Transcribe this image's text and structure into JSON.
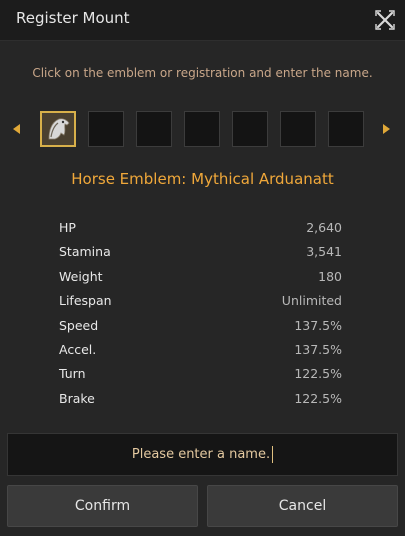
{
  "window": {
    "title": "Register Mount",
    "close_icon": "close-x-icon"
  },
  "instruction": "Click on the emblem or registration and enter the name.",
  "carousel": {
    "prev_icon": "triangle-left-icon",
    "next_icon": "triangle-right-icon",
    "slots": [
      {
        "icon": "horse-emblem-icon",
        "selected": true
      },
      {
        "icon": "",
        "selected": false
      },
      {
        "icon": "",
        "selected": false
      },
      {
        "icon": "",
        "selected": false
      },
      {
        "icon": "",
        "selected": false
      },
      {
        "icon": "",
        "selected": false
      },
      {
        "icon": "",
        "selected": false
      }
    ]
  },
  "emblem_name": "Horse Emblem: Mythical Arduanatt",
  "stats": [
    {
      "label": "HP",
      "value": "2,640"
    },
    {
      "label": "Stamina",
      "value": "3,541"
    },
    {
      "label": "Weight",
      "value": "180"
    },
    {
      "label": "Lifespan",
      "value": "Unlimited"
    },
    {
      "label": "Speed",
      "value": "137.5%"
    },
    {
      "label": "Accel.",
      "value": "137.5%"
    },
    {
      "label": "Turn",
      "value": "122.5%"
    },
    {
      "label": "Brake",
      "value": "122.5%"
    }
  ],
  "name_input": {
    "placeholder": "Please enter a name.",
    "value": ""
  },
  "buttons": {
    "confirm": "Confirm",
    "cancel": "Cancel"
  },
  "colors": {
    "accent_orange": "#f0a83a",
    "instruction_tan": "#c9a78a",
    "selected_border": "#d8b04a",
    "background": "#262626"
  }
}
